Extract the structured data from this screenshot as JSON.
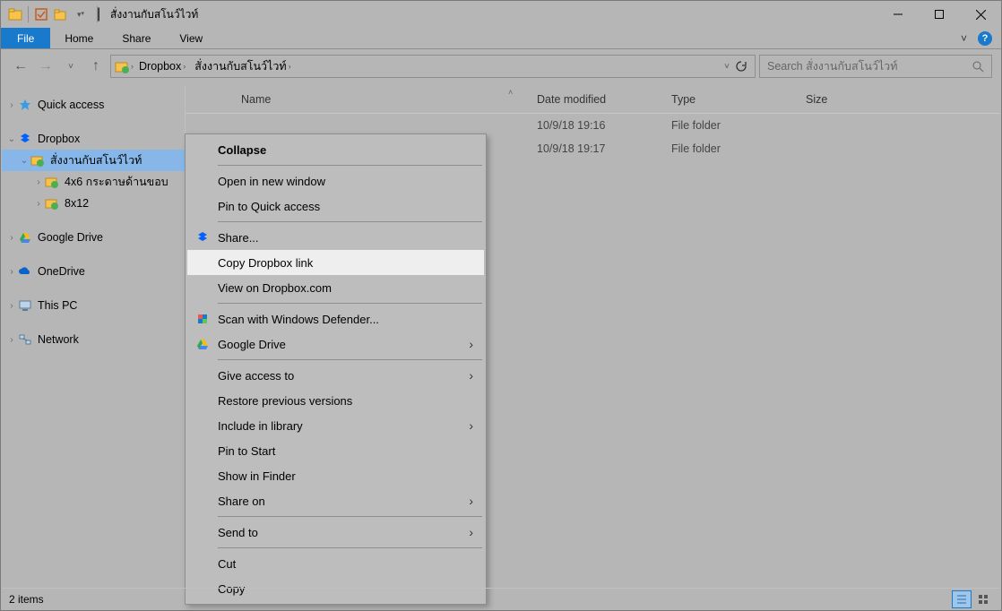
{
  "title": "สั่งงานกับสโนว์ไวท์",
  "ribbon": {
    "file": "File",
    "home": "Home",
    "share": "Share",
    "view": "View"
  },
  "breadcrumbs": [
    "Dropbox",
    "สั่งงานกับสโนว์ไวท์"
  ],
  "search_placeholder": "Search สั่งงานกับสโนว์ไวท์",
  "columns": {
    "name": "Name",
    "date": "Date modified",
    "type": "Type",
    "size": "Size"
  },
  "tree": {
    "quick_access": "Quick access",
    "dropbox": "Dropbox",
    "working": "สั่งงานกับสโนว์ไวท์",
    "sub1": "4x6 กระดาษด้านขอบ",
    "sub2": "8x12",
    "gdrive": "Google Drive",
    "onedrive": "OneDrive",
    "thispc": "This PC",
    "network": "Network"
  },
  "files": [
    {
      "date": "10/9/18 19:16",
      "type": "File folder"
    },
    {
      "date": "10/9/18 19:17",
      "type": "File folder"
    }
  ],
  "context": {
    "collapse": "Collapse",
    "open_new": "Open in new window",
    "pin_qa": "Pin to Quick access",
    "share": "Share...",
    "copy_link": "Copy Dropbox link",
    "view_db": "View on Dropbox.com",
    "defender": "Scan with Windows Defender...",
    "gdrive": "Google Drive",
    "give_access": "Give access to",
    "restore": "Restore previous versions",
    "include_lib": "Include in library",
    "pin_start": "Pin to Start",
    "show_finder": "Show in Finder",
    "share_on": "Share on",
    "send_to": "Send to",
    "cut": "Cut",
    "copy": "Copy"
  },
  "status": "2 items"
}
